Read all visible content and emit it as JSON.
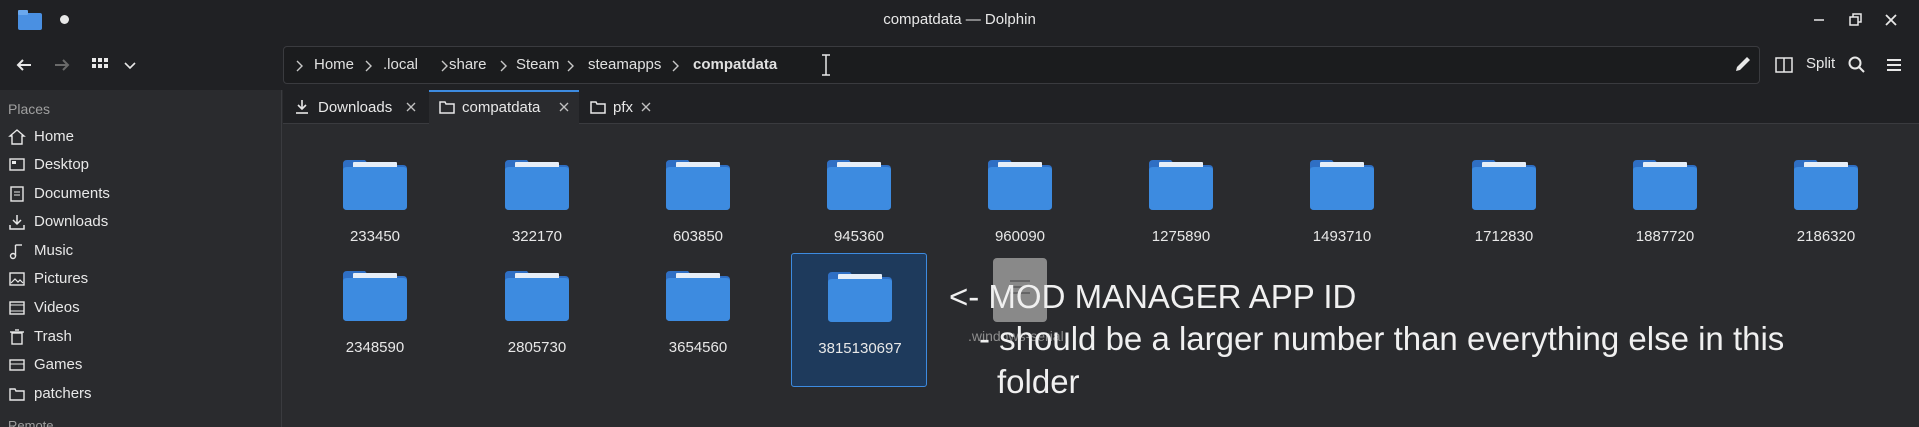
{
  "window": {
    "title": "compatdata — Dolphin"
  },
  "breadcrumb": {
    "items": [
      "Home",
      ".local",
      "share",
      "Steam",
      "steamapps",
      "compatdata"
    ]
  },
  "toolbar": {
    "split_label": "Split"
  },
  "sidebar": {
    "header": "Places",
    "items": [
      {
        "label": "Home",
        "icon": "home-icon"
      },
      {
        "label": "Desktop",
        "icon": "desktop-icon"
      },
      {
        "label": "Documents",
        "icon": "documents-icon"
      },
      {
        "label": "Downloads",
        "icon": "downloads-icon"
      },
      {
        "label": "Music",
        "icon": "music-icon"
      },
      {
        "label": "Pictures",
        "icon": "pictures-icon"
      },
      {
        "label": "Videos",
        "icon": "videos-icon"
      },
      {
        "label": "Trash",
        "icon": "trash-icon"
      },
      {
        "label": "Games",
        "icon": "games-icon"
      },
      {
        "label": "patchers",
        "icon": "folder-icon"
      }
    ],
    "remote_header": "Remote"
  },
  "tabs": [
    {
      "label": "Downloads",
      "icon": "download-icon"
    },
    {
      "label": "compatdata",
      "icon": "folder-icon"
    },
    {
      "label": "pfx",
      "icon": "folder-icon"
    }
  ],
  "folders": [
    "233450",
    "322170",
    "603850",
    "945360",
    "960090",
    "1275890",
    "1493710",
    "1712830",
    "1887720",
    "2186320",
    "2348590",
    "2805730",
    "3654560",
    "3815130697"
  ],
  "drag_ghost": {
    "label": ".windows-serial"
  },
  "annotation": {
    "line1": "<- MOD MANAGER APP ID",
    "line2": "- should be a larger number than everything else in this",
    "line3": "folder"
  },
  "colors": {
    "accent": "#3d8be0",
    "folder": "#3d8be0",
    "background": "#2a2b2e"
  }
}
